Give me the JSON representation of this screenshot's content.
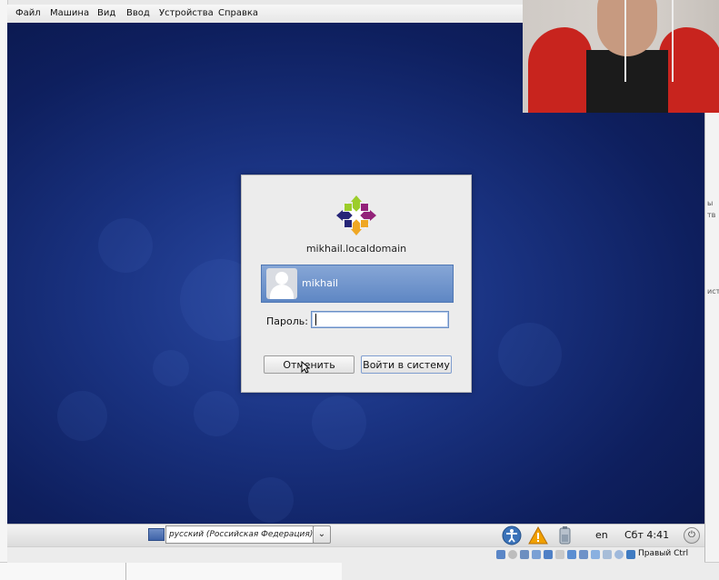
{
  "vm_menu": {
    "items": [
      {
        "label": "Файл"
      },
      {
        "label": "Машина"
      },
      {
        "label": "Вид"
      },
      {
        "label": "Ввод"
      },
      {
        "label": "Устройства"
      },
      {
        "label": "Справка"
      }
    ]
  },
  "login_dialog": {
    "hostname": "mikhail.localdomain",
    "user_name": "mikhail",
    "password_label": "Пароль:",
    "password_value": "",
    "cancel_label": "Отменить",
    "login_label": "Войти в систему"
  },
  "panel": {
    "language": "русский (Российская Федерация)",
    "keyboard_layout": "en",
    "clock": "Сбт  4:41"
  },
  "statusbar": {
    "host_key": "Правый Ctrl"
  },
  "colors": {
    "desktop_blue": "#1a3382",
    "selected_user": "#6f93cc",
    "menubar": "#ececec"
  },
  "icons": {
    "logo": "centos-logo",
    "accessibility": "accessibility-icon",
    "warning": "warning-icon",
    "battery": "battery-icon",
    "power": "power-icon",
    "flag": "keyboard-flag-icon"
  }
}
